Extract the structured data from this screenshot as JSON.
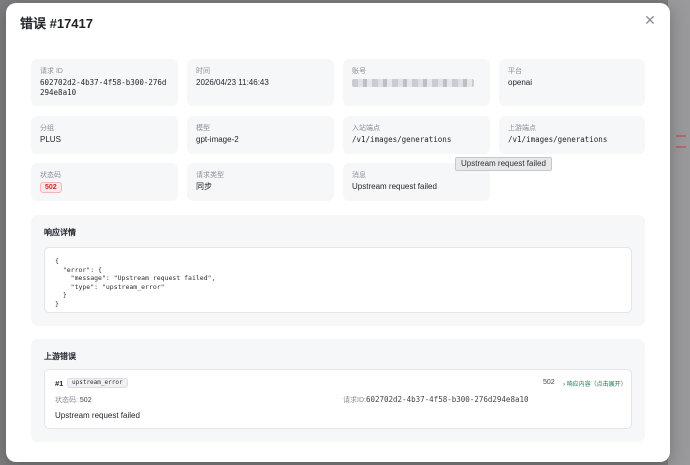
{
  "dialog": {
    "title": "错误 #17417",
    "close_icon": "close-icon"
  },
  "fields": [
    {
      "key": "request_id",
      "label": "请求 ID",
      "value": "602702d2-4b37-4f58-b300-276d294e8a10"
    },
    {
      "key": "time",
      "label": "时间",
      "value": "2026/04/23 11:46:43"
    },
    {
      "key": "account",
      "label": "账号",
      "value": ""
    },
    {
      "key": "platform",
      "label": "平台",
      "value": "openai"
    },
    {
      "key": "group",
      "label": "分组",
      "value": "PLUS"
    },
    {
      "key": "model",
      "label": "模型",
      "value": "gpt-image-2"
    },
    {
      "key": "inbound",
      "label": "入站端点",
      "value": "/v1/images/generations"
    },
    {
      "key": "upstream_ep",
      "label": "上游端点",
      "value": "/v1/images/generations"
    },
    {
      "key": "status",
      "label": "状态码",
      "value": "502"
    },
    {
      "key": "req_type",
      "label": "请求类型",
      "value": "同步"
    },
    {
      "key": "message",
      "label": "消息",
      "value": "Upstream request failed"
    }
  ],
  "tooltip": "Upstream request failed",
  "response": {
    "title": "响应详情",
    "body": "{\n  \"error\": {\n    \"message\": \"Upstream request failed\",\n    \"type\": \"upstream_error\"\n  }\n}"
  },
  "upstream": {
    "title": "上游错误",
    "entry": {
      "index": "#1",
      "type": "upstream_error",
      "code": "502",
      "link": "› 响应内容（点击展开）",
      "status_label": "状态码:",
      "status_value": "502",
      "reqid_label": "请求ID:",
      "reqid_value": "602702d2-4b37-4f58-b300-276d294e8a10",
      "message": "Upstream request failed"
    }
  },
  "colors": {
    "accent_link": "#1d7a4a",
    "status_error": "#c62828"
  }
}
